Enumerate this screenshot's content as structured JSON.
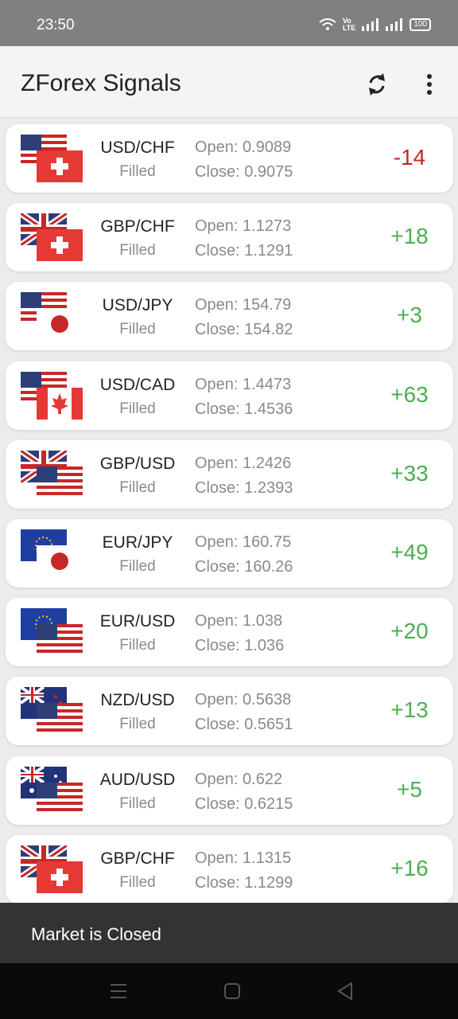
{
  "status_bar": {
    "time": "23:50",
    "battery": "100"
  },
  "app_bar": {
    "title": "ZForex Signals",
    "icons": [
      "refresh-icon",
      "more-vert-icon"
    ]
  },
  "signals": [
    {
      "pair": "USD/CHF",
      "status": "Filled",
      "open": "Open: 0.9089",
      "close": "Close: 0.9075",
      "pips": "-14",
      "base_flag": "US",
      "quote_flag": "CH"
    },
    {
      "pair": "GBP/CHF",
      "status": "Filled",
      "open": "Open: 1.1273",
      "close": "Close: 1.1291",
      "pips": "+18",
      "base_flag": "GB",
      "quote_flag": "CH"
    },
    {
      "pair": "USD/JPY",
      "status": "Filled",
      "open": "Open: 154.79",
      "close": "Close: 154.82",
      "pips": "+3",
      "base_flag": "US",
      "quote_flag": "JP"
    },
    {
      "pair": "USD/CAD",
      "status": "Filled",
      "open": "Open: 1.4473",
      "close": "Close: 1.4536",
      "pips": "+63",
      "base_flag": "US",
      "quote_flag": "CA"
    },
    {
      "pair": "GBP/USD",
      "status": "Filled",
      "open": "Open: 1.2426",
      "close": "Close: 1.2393",
      "pips": "+33",
      "base_flag": "GB",
      "quote_flag": "US"
    },
    {
      "pair": "EUR/JPY",
      "status": "Filled",
      "open": "Open: 160.75",
      "close": "Close: 160.26",
      "pips": "+49",
      "base_flag": "EU",
      "quote_flag": "JP"
    },
    {
      "pair": "EUR/USD",
      "status": "Filled",
      "open": "Open: 1.038",
      "close": "Close: 1.036",
      "pips": "+20",
      "base_flag": "EU",
      "quote_flag": "US"
    },
    {
      "pair": "NZD/USD",
      "status": "Filled",
      "open": "Open: 0.5638",
      "close": "Close: 0.5651",
      "pips": "+13",
      "base_flag": "NZ",
      "quote_flag": "US"
    },
    {
      "pair": "AUD/USD",
      "status": "Filled",
      "open": "Open: 0.622",
      "close": "Close: 0.6215",
      "pips": "+5",
      "base_flag": "AU",
      "quote_flag": "US"
    },
    {
      "pair": "GBP/CHF",
      "status": "Filled",
      "open": "Open: 1.1315",
      "close": "Close: 1.1299",
      "pips": "+16",
      "base_flag": "GB",
      "quote_flag": "CH"
    }
  ],
  "colors": {
    "positive": "#4caf50",
    "negative": "#c62828",
    "accent": "#333333"
  },
  "snackbar": {
    "text": "Market is Closed"
  },
  "nav_bar": {
    "icons": [
      "recents-icon",
      "home-icon",
      "back-icon"
    ]
  }
}
